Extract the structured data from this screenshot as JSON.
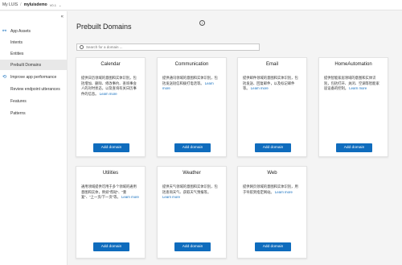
{
  "topbar": {
    "app": "My LUIS",
    "sep": "/",
    "project": "myluisdemo",
    "version": "V0.1",
    "chevron": "⌄"
  },
  "sidebar": {
    "collapse_icon": "«",
    "items": [
      {
        "label": "App Assets",
        "icon": "⚯"
      },
      {
        "label": "Intents"
      },
      {
        "label": "Entities"
      },
      {
        "label": "Prebuilt Domains"
      },
      {
        "label": "Improve app performance",
        "icon": "⟲"
      },
      {
        "label": "Review endpoint utterances"
      },
      {
        "label": "Features"
      },
      {
        "label": "Patterns"
      }
    ]
  },
  "main": {
    "title": "Prebuilt Domains",
    "info_icon": "i",
    "search_placeholder": "Search for a domain ...",
    "cards": [
      {
        "title": "Calendar",
        "desc": "提供日历领域的意图和实体识别，包括增加、删除、修改事约、查询事会人的对时状态，以及查询有关日历事件的信息。",
        "more": "Learn more",
        "button": "Add domain"
      },
      {
        "title": "Communication",
        "desc": "提供通讯领域的意图和实体识别，包括发送短信和拨打电话等。",
        "more": "Learn more",
        "button": "Add domain"
      },
      {
        "title": "Email",
        "desc": "提供邮件领域的意图和实体识别，包括发送、回复邮件，以及标记邮件等。",
        "more": "Learn more",
        "button": "Add domain"
      },
      {
        "title": "HomeAutomation",
        "desc": "提供智能家居领域的意图和实体识别，包括打开、关闭、空调等智能家居设备的控制。",
        "more": "Learn more",
        "button": "Add domain"
      },
      {
        "title": "Utilities",
        "desc": "通用领域提供可用于多个领域的通用意图和实体，例如\"帮助\"、\"重复\"、\"上一页/下一页\"等。",
        "more": "Learn more",
        "button": "Add domain"
      },
      {
        "title": "Weather",
        "desc": "提供天气领域的意图和实体识别，包括查询天气、获取天气预报等。",
        "more": "Learn more",
        "button": "Add domain"
      },
      {
        "title": "Web",
        "desc": "提供网页领域的意图和实体识别，用于导航到指定网站。",
        "more": "Learn more",
        "button": "Add domain"
      }
    ]
  }
}
